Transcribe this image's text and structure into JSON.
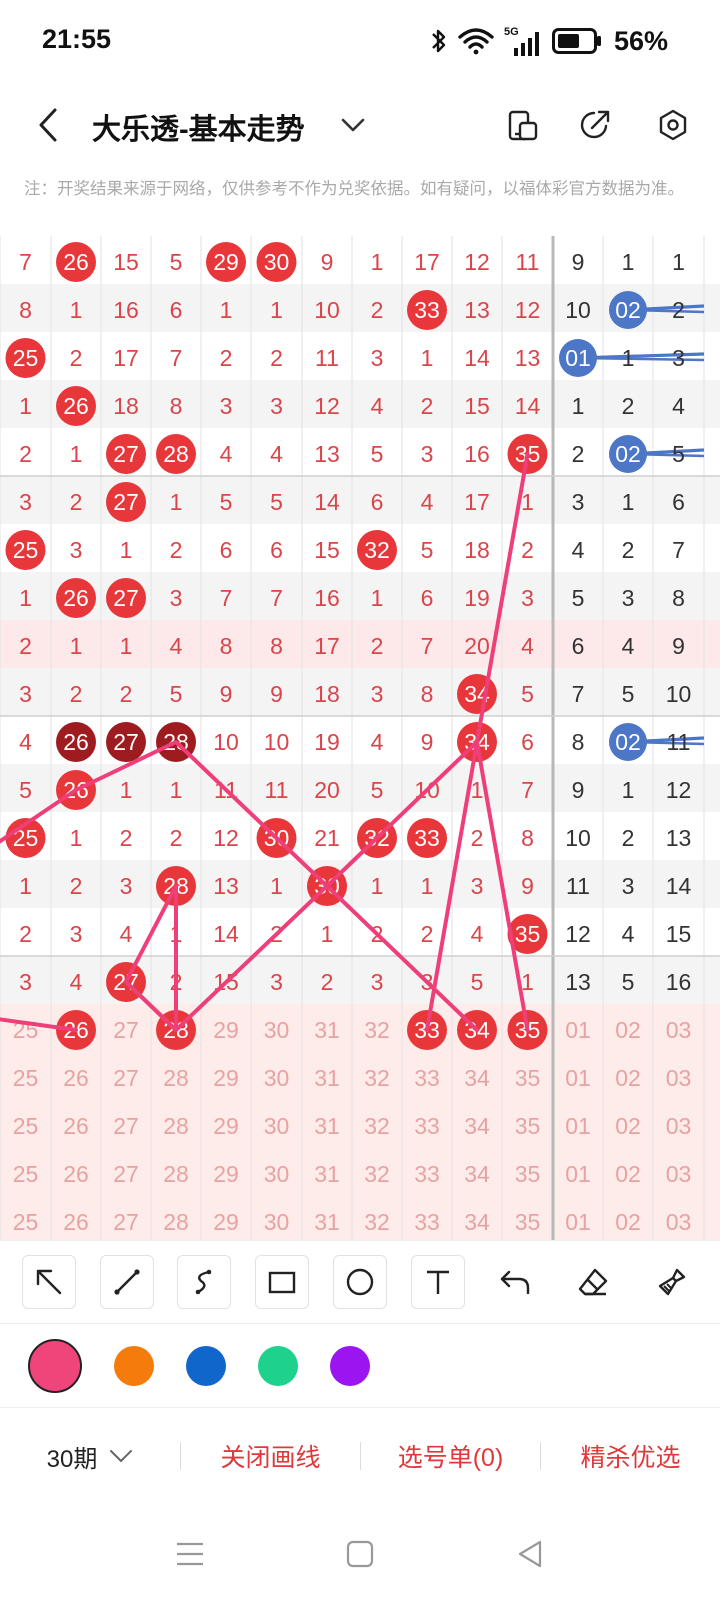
{
  "status": {
    "time": "21:55",
    "battery_text": "56%",
    "network": "5G"
  },
  "header": {
    "title": "大乐透-基本走势",
    "icons": [
      "back-icon",
      "chevron-down-icon",
      "phone-rotate-icon",
      "share-icon",
      "settings-icon"
    ]
  },
  "notice": "注：开奖结果来源于网络，仅供参考不作为兑奖依据。如有疑问，以福体彩官方数据为准。",
  "grid": {
    "rows": [
      {
        "cells": [
          "7",
          "26",
          "15",
          "5",
          "29",
          "30",
          "9",
          "1",
          "17",
          "12",
          "11"
        ],
        "hits": [
          1,
          4,
          5
        ],
        "blue": [
          "9",
          "1",
          "1"
        ],
        "bhits": []
      },
      {
        "cells": [
          "8",
          "1",
          "16",
          "6",
          "1",
          "1",
          "10",
          "2",
          "33",
          "13",
          "12"
        ],
        "hits": [
          8
        ],
        "blue": [
          "10",
          "02",
          "2"
        ],
        "bhits": [
          1
        ]
      },
      {
        "cells": [
          "25",
          "2",
          "17",
          "7",
          "2",
          "2",
          "11",
          "3",
          "1",
          "14",
          "13"
        ],
        "hits": [
          0
        ],
        "blue": [
          "01",
          "1",
          "3"
        ],
        "bhits": [
          0
        ]
      },
      {
        "cells": [
          "1",
          "26",
          "18",
          "8",
          "3",
          "3",
          "12",
          "4",
          "2",
          "15",
          "14"
        ],
        "hits": [
          1
        ],
        "blue": [
          "1",
          "2",
          "4"
        ],
        "bhits": []
      },
      {
        "cells": [
          "2",
          "1",
          "27",
          "28",
          "4",
          "4",
          "13",
          "5",
          "3",
          "16",
          "35"
        ],
        "hits": [
          2,
          3,
          10
        ],
        "blue": [
          "2",
          "02",
          "5"
        ],
        "bhits": [
          1
        ]
      },
      {
        "cells": [
          "3",
          "2",
          "27",
          "1",
          "5",
          "5",
          "14",
          "6",
          "4",
          "17",
          "1"
        ],
        "hits": [
          2
        ],
        "blue": [
          "3",
          "1",
          "6"
        ],
        "bhits": []
      },
      {
        "cells": [
          "25",
          "3",
          "1",
          "2",
          "6",
          "6",
          "15",
          "32",
          "5",
          "18",
          "2"
        ],
        "hits": [
          0,
          7
        ],
        "blue": [
          "4",
          "2",
          "7"
        ],
        "bhits": []
      },
      {
        "cells": [
          "1",
          "26",
          "27",
          "3",
          "7",
          "7",
          "16",
          "1",
          "6",
          "19",
          "3"
        ],
        "hits": [
          1,
          2
        ],
        "blue": [
          "5",
          "3",
          "8"
        ],
        "bhits": []
      },
      {
        "cells": [
          "2",
          "1",
          "1",
          "4",
          "8",
          "8",
          "17",
          "2",
          "7",
          "20",
          "4"
        ],
        "hits": [],
        "blue": [
          "6",
          "4",
          "9"
        ],
        "bhits": []
      },
      {
        "cells": [
          "3",
          "2",
          "2",
          "5",
          "9",
          "9",
          "18",
          "3",
          "8",
          "34",
          "5"
        ],
        "hits": [
          9
        ],
        "blue": [
          "7",
          "5",
          "10"
        ],
        "bhits": []
      },
      {
        "cells": [
          "4",
          "26",
          "27",
          "28",
          "10",
          "10",
          "19",
          "4",
          "9",
          "34",
          "6"
        ],
        "hits": [
          1,
          2,
          3,
          9
        ],
        "dark": [
          1,
          2,
          3
        ],
        "blue": [
          "8",
          "02",
          "11"
        ],
        "bhits": [
          1
        ]
      },
      {
        "cells": [
          "5",
          "26",
          "1",
          "1",
          "11",
          "11",
          "20",
          "5",
          "10",
          "1",
          "7"
        ],
        "hits": [
          1
        ],
        "blue": [
          "9",
          "1",
          "12"
        ],
        "bhits": []
      },
      {
        "cells": [
          "25",
          "1",
          "2",
          "2",
          "12",
          "30",
          "21",
          "32",
          "33",
          "2",
          "8"
        ],
        "hits": [
          0,
          5,
          7,
          8
        ],
        "blue": [
          "10",
          "2",
          "13"
        ],
        "bhits": []
      },
      {
        "cells": [
          "1",
          "2",
          "3",
          "28",
          "13",
          "1",
          "30",
          "1",
          "1",
          "3",
          "9"
        ],
        "hits": [
          3,
          6
        ],
        "blue": [
          "11",
          "3",
          "14"
        ],
        "bhits": []
      },
      {
        "cells": [
          "2",
          "3",
          "4",
          "1",
          "14",
          "2",
          "1",
          "2",
          "2",
          "4",
          "35"
        ],
        "hits": [
          10
        ],
        "blue": [
          "12",
          "4",
          "15"
        ],
        "bhits": []
      },
      {
        "cells": [
          "3",
          "4",
          "27",
          "2",
          "15",
          "3",
          "2",
          "3",
          "3",
          "5",
          "1"
        ],
        "hits": [
          2
        ],
        "blue": [
          "13",
          "5",
          "16"
        ],
        "bhits": []
      },
      {
        "cells": [
          "25",
          "26",
          "27",
          "28",
          "29",
          "30",
          "31",
          "32",
          "33",
          "34",
          "35"
        ],
        "hits": [
          1,
          3,
          8,
          9,
          10
        ],
        "blue": [
          "01",
          "02",
          "03"
        ],
        "bhits": [],
        "pred": true
      },
      {
        "cells": [
          "25",
          "26",
          "27",
          "28",
          "29",
          "30",
          "31",
          "32",
          "33",
          "34",
          "35"
        ],
        "hits": [],
        "blue": [
          "01",
          "02",
          "03"
        ],
        "bhits": [],
        "pred": true
      },
      {
        "cells": [
          "25",
          "26",
          "27",
          "28",
          "29",
          "30",
          "31",
          "32",
          "33",
          "34",
          "35"
        ],
        "hits": [],
        "blue": [
          "01",
          "02",
          "03"
        ],
        "bhits": [],
        "pred": true
      },
      {
        "cells": [
          "25",
          "26",
          "27",
          "28",
          "29",
          "30",
          "31",
          "32",
          "33",
          "34",
          "35"
        ],
        "hits": [],
        "blue": [
          "01",
          "02",
          "03"
        ],
        "bhits": [],
        "pred": true
      },
      {
        "cells": [
          "25",
          "26",
          "27",
          "28",
          "29",
          "30",
          "31",
          "32",
          "33",
          "34",
          "35"
        ],
        "hits": [],
        "blue": [
          "01",
          "02",
          "03"
        ],
        "bhits": [],
        "pred": true
      }
    ]
  },
  "tools": [
    "arrow-tool-icon",
    "line-tool-icon",
    "curve-tool-icon",
    "rectangle-tool-icon",
    "circle-tool-icon",
    "text-tool-icon",
    "undo-icon",
    "eraser-icon",
    "clear-brush-icon"
  ],
  "colors": [
    "#f0457a",
    "#f57c0b",
    "#1166cc",
    "#1ed18d",
    "#9b15f0"
  ],
  "bottom": {
    "period": "30期",
    "close_lines": "关闭画线",
    "selection": "选号单(0)",
    "premium": "精杀优选"
  }
}
